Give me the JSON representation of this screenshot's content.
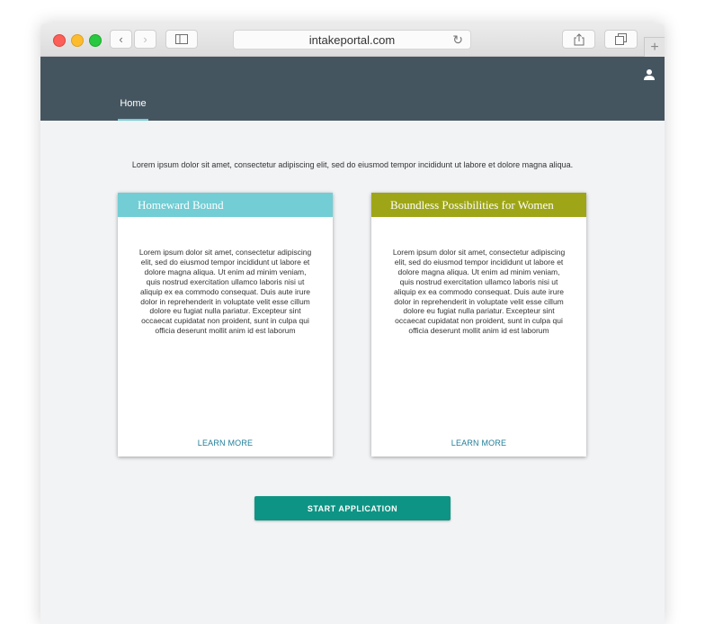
{
  "browser": {
    "url": "intakeportal.com",
    "back_glyph": "‹",
    "forward_glyph": "›",
    "reload_glyph": "↻",
    "newtab_glyph": "+"
  },
  "nav": {
    "home_label": "Home"
  },
  "intro_text": "Lorem ipsum dolor sit amet, consectetur adipiscing elit, sed do eiusmod tempor incididunt ut labore et dolore magna aliqua.",
  "cards": [
    {
      "title": "Homeward Bound",
      "color": "#72cdd4",
      "body": "Lorem ipsum dolor sit amet, consectetur adipiscing elit, sed do eiusmod tempor incididunt ut labore et dolore magna aliqua. Ut enim ad minim veniam, quis nostrud exercitation ullamco laboris nisi ut aliquip ex ea commodo consequat. Duis aute irure dolor in reprehenderit in voluptate velit esse cillum dolore eu fugiat nulla pariatur. Excepteur sint occaecat cupidatat non proident, sunt in culpa qui officia deserunt mollit anim id est laborum",
      "link_label": "LEARN MORE"
    },
    {
      "title": "Boundless Possibilities for Women",
      "color": "#9ea617",
      "body": "Lorem ipsum dolor sit amet, consectetur adipiscing elit, sed do eiusmod tempor incididunt ut labore et dolore magna aliqua. Ut enim ad minim veniam, quis nostrud exercitation ullamco laboris nisi ut aliquip ex ea commodo consequat. Duis aute irure dolor in reprehenderit in voluptate velit esse cillum dolore eu fugiat nulla pariatur. Excepteur sint occaecat cupidatat non proident, sunt in culpa qui officia deserunt mollit anim id est laborum",
      "link_label": "LEARN MORE"
    }
  ],
  "start_button_label": "START APPLICATION",
  "colors": {
    "appbar": "#455560",
    "accent_underline": "#76cfd6",
    "primary_button": "#0e9484",
    "link": "#1f7e9a"
  },
  "icons": [
    "back-icon",
    "forward-icon",
    "sidebar-icon",
    "reload-icon",
    "share-icon",
    "tabs-icon",
    "new-tab-icon",
    "user-icon"
  ]
}
